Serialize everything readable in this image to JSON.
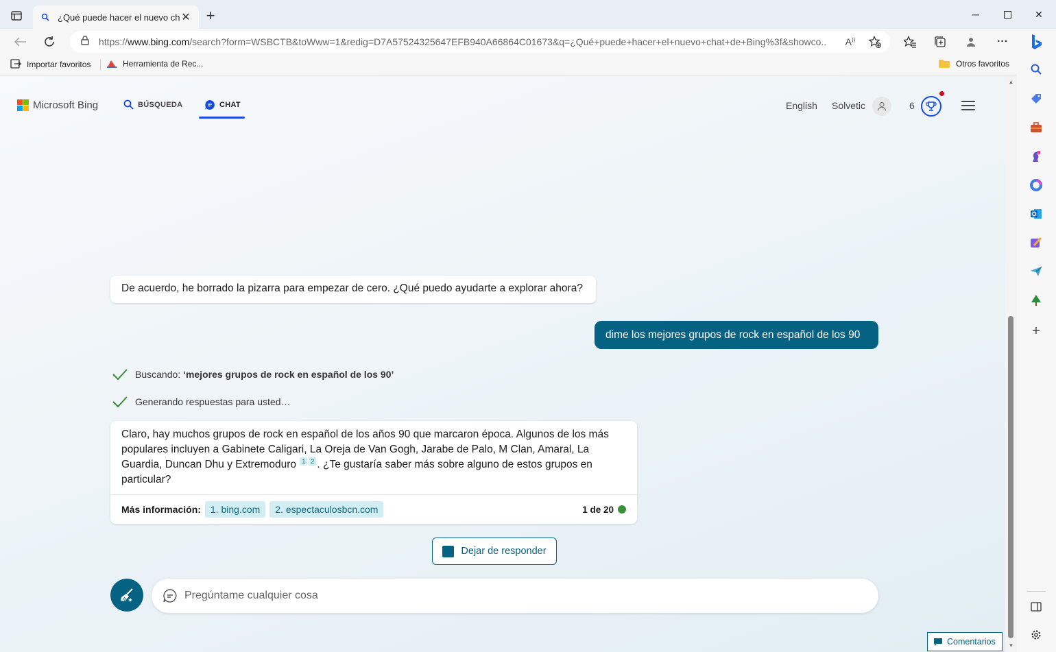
{
  "browser": {
    "tab_title": "¿Qué puede hacer el nuevo chat de Bing?",
    "url_prefix": "https://",
    "url_host": "www.bing.com",
    "url_rest": "/search?form=WSBCTB&toWww=1&redig=D7A57524325647EFB940A66864C01673&q=¿Qué+puede+hacer+el+nuevo+chat+de+Bing%3f&showco...",
    "favorites": {
      "import_label": "Importar favoritos",
      "tool_label": "Herramienta de Rec...",
      "other_label": "Otros favoritos"
    }
  },
  "header": {
    "brand": "Microsoft Bing",
    "nav_search": "BÚSQUEDA",
    "nav_chat": "CHAT",
    "language": "English",
    "user": "Solvetic",
    "points": "6"
  },
  "chat": {
    "greeting": "De acuerdo, he borrado la pizarra para empezar de cero. ¿Qué puedo ayudarte a explorar ahora?",
    "user_message": "dime los mejores grupos de rock en español de los 90",
    "status_search_prefix": "Buscando: ",
    "status_search_query": "‘mejores grupos de rock en español de los 90’",
    "status_generating": "Generando respuestas para usted…",
    "answer_part1": "Claro, hay muchos grupos de rock en español de los años 90 que marcaron época. Algunos de los más populares incluyen a Gabinete Caligari, La Oreja de Van Gogh, Jarabe de Palo, M Clan, Amaral, La Guardia, Duncan Dhu y Extremoduro",
    "cite1": "1",
    "cite2": "2",
    "answer_part2": ". ¿Te gustaría saber más sobre alguno de estos grupos en particular?",
    "learn_more_label": "Más información:",
    "sources": [
      "1. bing.com",
      "2. espectaculosbcn.com"
    ],
    "counter": "1 de 20",
    "stop_label": "Dejar de responder",
    "input_placeholder": "Pregúntame cualquier cosa",
    "feedback_label": "Comentarios"
  },
  "colors": {
    "accent": "#066283",
    "bing_blue": "#174ae4",
    "check_green": "#3a8f3a"
  }
}
